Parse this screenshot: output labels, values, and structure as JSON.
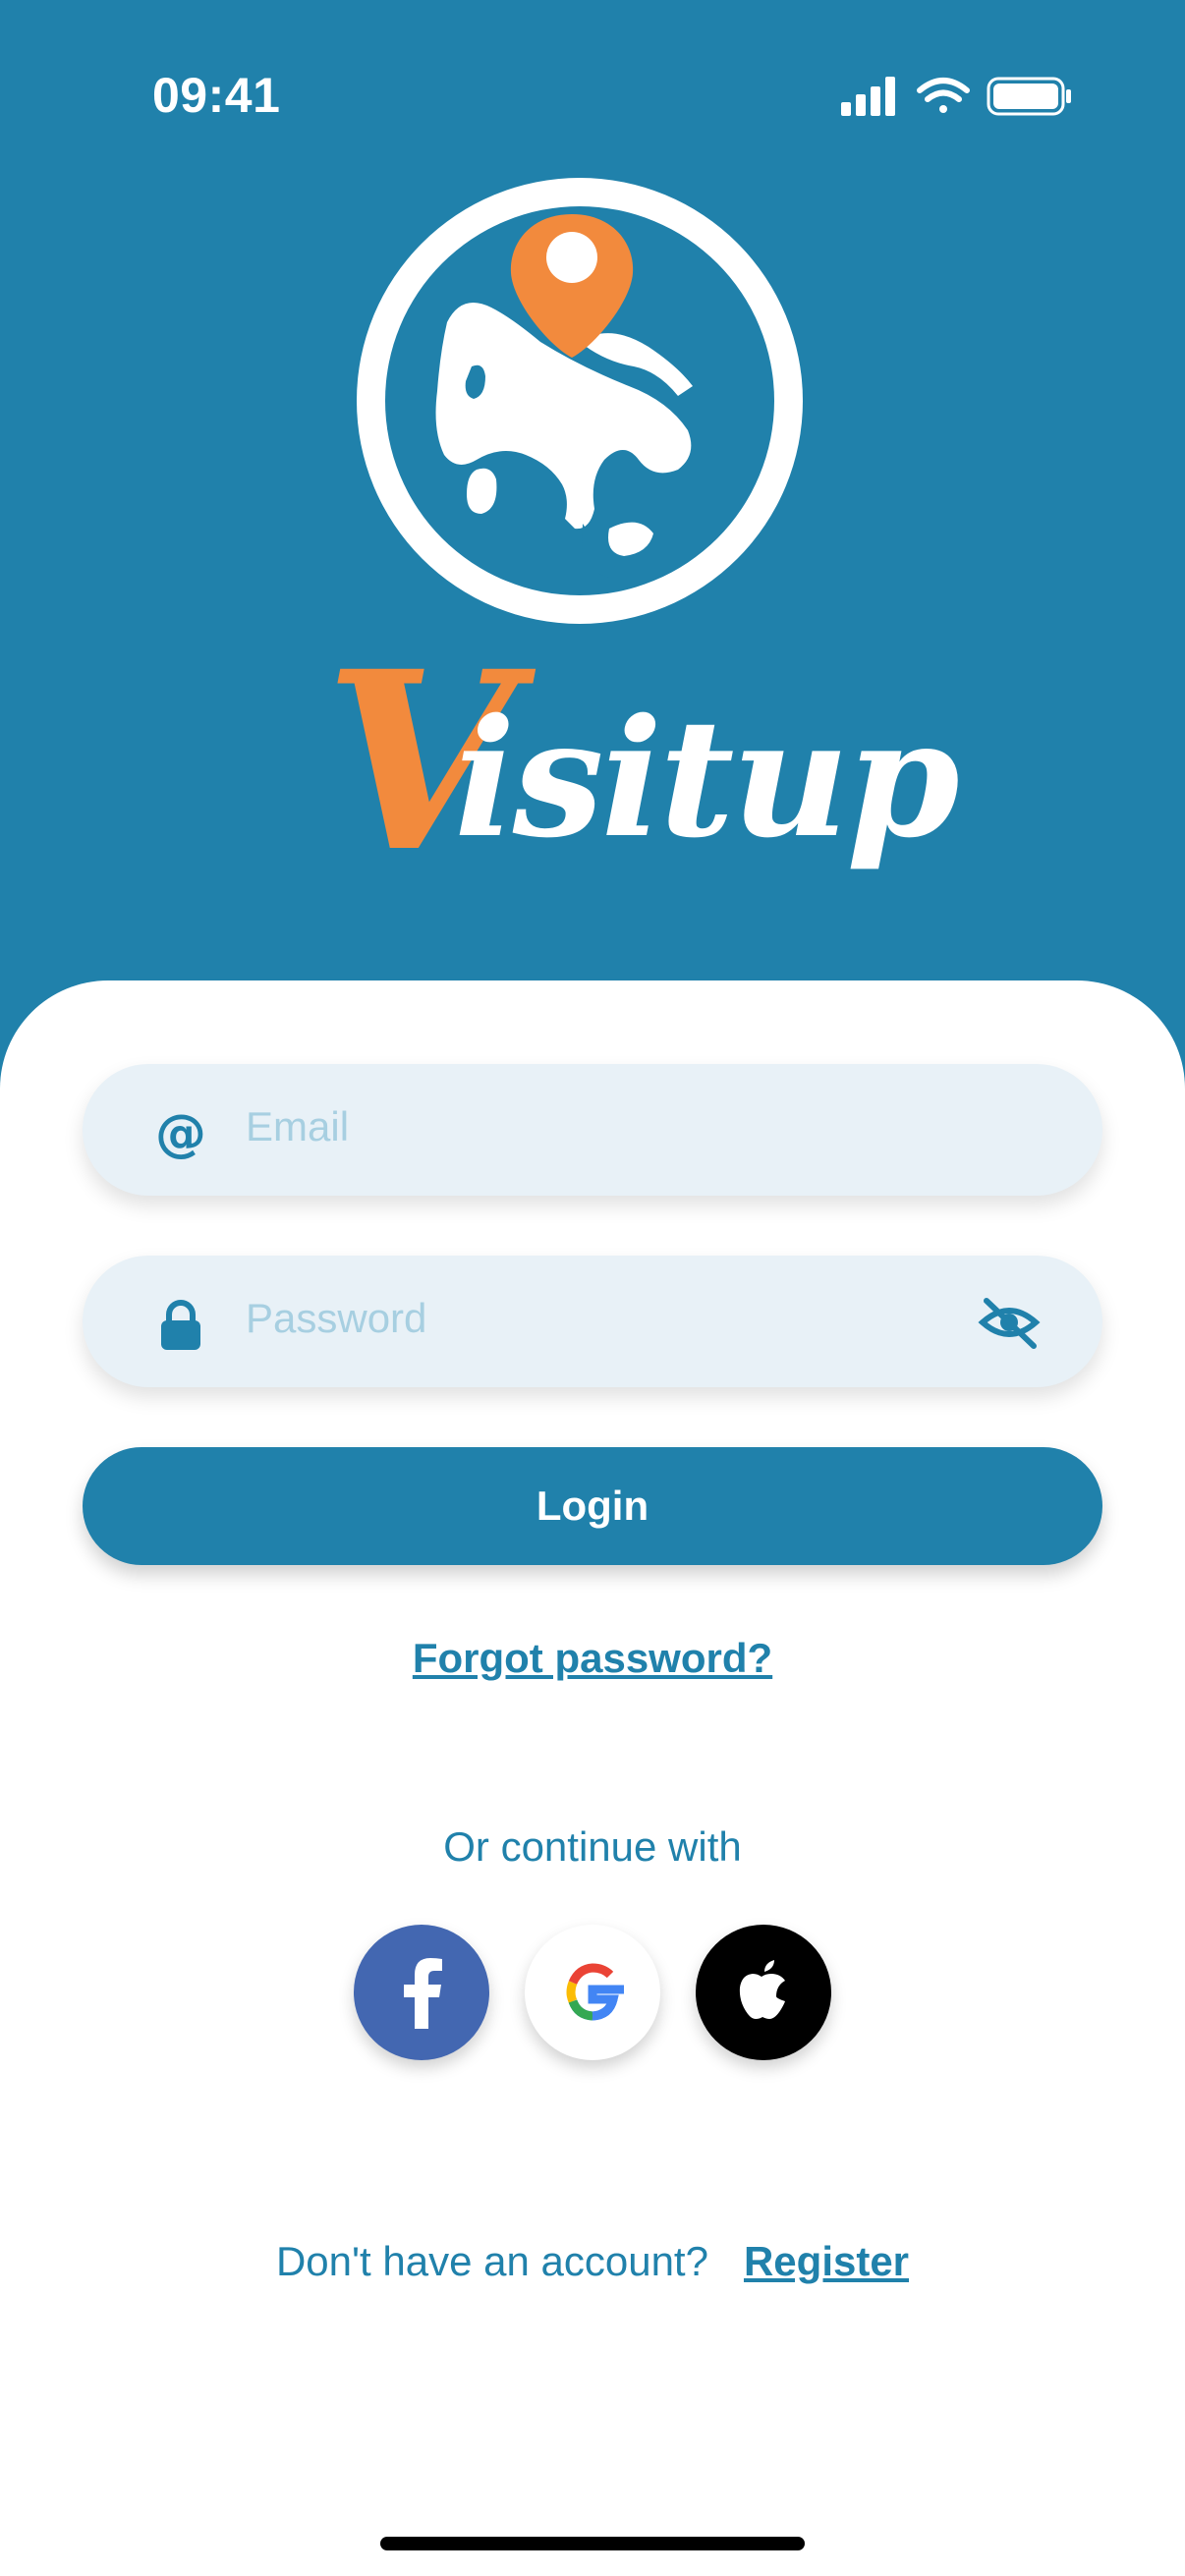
{
  "status_bar": {
    "time": "09:41",
    "icons": [
      "signal-icon",
      "wifi-icon",
      "battery-icon"
    ]
  },
  "brand": {
    "logo": "globe-location-logo",
    "first_letter": "V",
    "rest": "isitup"
  },
  "form": {
    "email_placeholder": "Email",
    "password_placeholder": "Password",
    "login_label": "Login",
    "forgot_label": "Forgot password?"
  },
  "social": {
    "heading": "Or continue with",
    "providers": [
      "facebook-icon",
      "google-icon",
      "apple-icon"
    ]
  },
  "footer": {
    "prompt": "Don't have an account?",
    "register_label": "Register"
  },
  "colors": {
    "primary": "#2081ab",
    "accent": "#f28a3d",
    "field_bg": "#e8f1f7",
    "placeholder": "#a7cfe1",
    "facebook": "#4367b1"
  }
}
